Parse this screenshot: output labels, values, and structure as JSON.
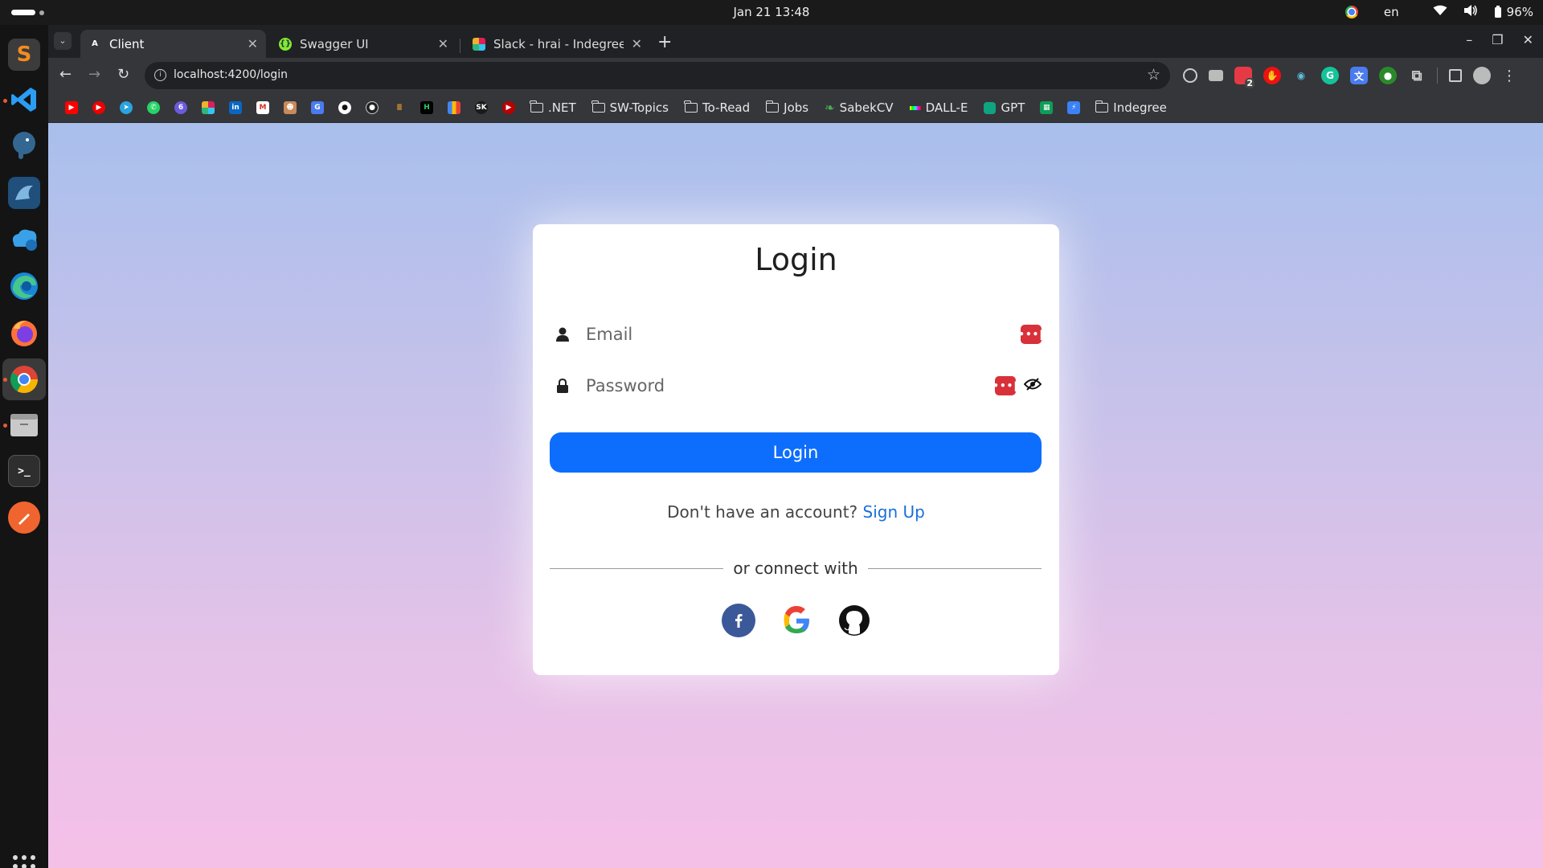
{
  "system": {
    "clock": "Jan 21  13:48",
    "language": "en",
    "battery": "96%"
  },
  "tabs": [
    {
      "label": "Client",
      "active": true
    },
    {
      "label": "Swagger UI",
      "active": false
    },
    {
      "label": "Slack - hrai - Indegree",
      "active": false
    }
  ],
  "address": {
    "url": "localhost:4200/login"
  },
  "extensions": {
    "badge": "2"
  },
  "bookmarks": {
    "folders": [
      ".NET",
      "SW-Topics",
      "To-Read",
      "Jobs"
    ],
    "links": [
      "SabekCV",
      "DALL-E",
      "GPT"
    ],
    "last_folder": "Indegree"
  },
  "login": {
    "title": "Login",
    "email_placeholder": "Email",
    "password_placeholder": "Password",
    "button": "Login",
    "no_account": "Don't have an account?",
    "signup_link": "Sign Up",
    "connect_with": "or connect with"
  },
  "colors": {
    "primary": "#0d6efd",
    "facebook": "#3b5998",
    "password_manager": "#d8313a"
  }
}
